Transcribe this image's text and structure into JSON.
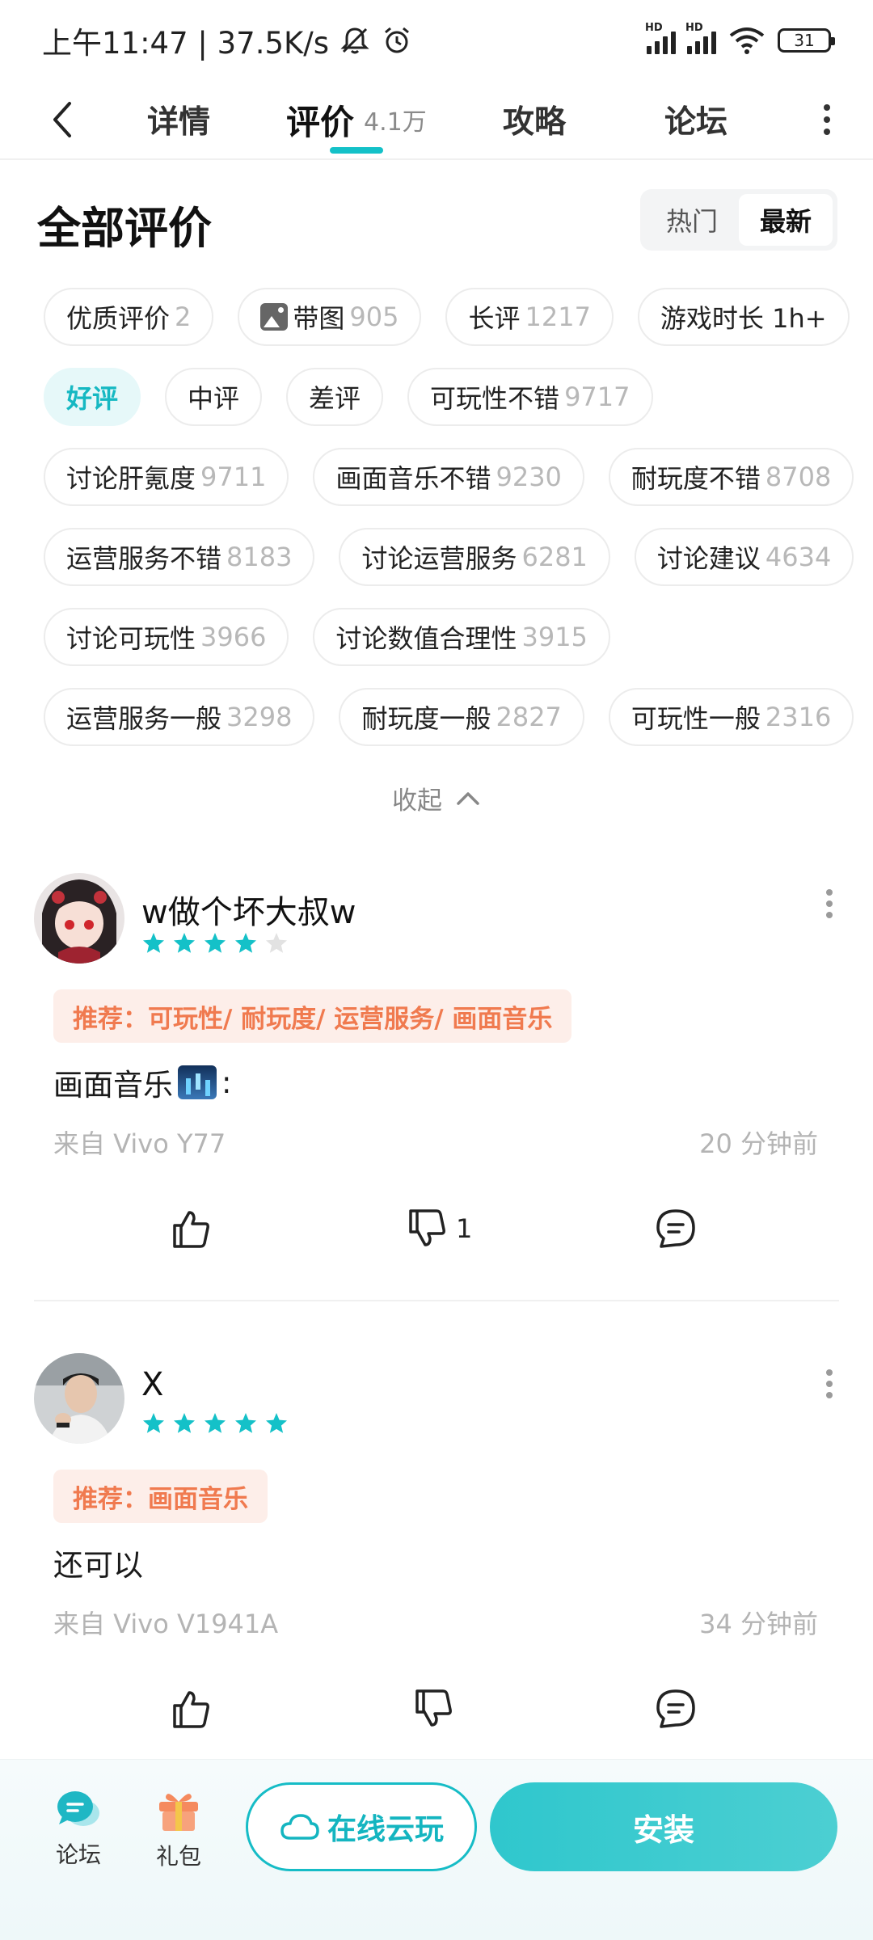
{
  "status_bar": {
    "time_speed": "上午11:47 | 37.5K/s",
    "battery": "31",
    "hd_label": "HD"
  },
  "nav": {
    "tabs": [
      {
        "label": "详情"
      },
      {
        "label": "评价",
        "count": "4.1万"
      },
      {
        "label": "攻略"
      },
      {
        "label": "论坛"
      }
    ]
  },
  "section": {
    "title": "全部评价",
    "sort": [
      "热门",
      "最新"
    ],
    "sort_selected": "最新"
  },
  "filters": [
    [
      {
        "label": "优质评价",
        "count": "2"
      },
      {
        "label": "带图",
        "count": "905",
        "icon": "image-icon"
      },
      {
        "label": "长评",
        "count": "1217"
      },
      {
        "label": "游戏时长 1h+",
        "count": ""
      }
    ],
    [
      {
        "label": "好评",
        "count": "",
        "active": true
      },
      {
        "label": "中评",
        "count": ""
      },
      {
        "label": "差评",
        "count": ""
      },
      {
        "label": "可玩性不错",
        "count": "9717"
      }
    ],
    [
      {
        "label": "讨论肝氪度",
        "count": "9711"
      },
      {
        "label": "画面音乐不错",
        "count": "9230"
      },
      {
        "label": "耐玩度不错",
        "count": "8708"
      }
    ],
    [
      {
        "label": "运营服务不错",
        "count": "8183"
      },
      {
        "label": "讨论运营服务",
        "count": "6281"
      },
      {
        "label": "讨论建议",
        "count": "4634"
      }
    ],
    [
      {
        "label": "讨论可玩性",
        "count": "3966"
      },
      {
        "label": "讨论数值合理性",
        "count": "3915"
      }
    ],
    [
      {
        "label": "运营服务一般",
        "count": "3298"
      },
      {
        "label": "耐玩度一般",
        "count": "2827"
      },
      {
        "label": "可玩性一般",
        "count": "2316"
      }
    ]
  ],
  "collapse_label": "收起",
  "reviews": [
    {
      "username": "w做个坏大叔w",
      "rating": 4,
      "recommend": "推荐：可玩性/ 耐玩度/ 运营服务/ 画面音乐",
      "text": "画面音乐",
      "text_suffix": ":",
      "device": "来自 Vivo Y77",
      "time": "20 分钟前",
      "dislikes": "1"
    },
    {
      "username": "X",
      "rating": 5,
      "recommend": "推荐：画面音乐",
      "text": "还可以",
      "device": "来自 Vivo V1941A",
      "time": "34 分钟前",
      "dislikes": ""
    }
  ],
  "bottom_bar": {
    "forum_label": "论坛",
    "gift_label": "礼包",
    "cloud_play_label": "在线云玩",
    "install_label": "安装"
  },
  "colors": {
    "accent": "#14c1c8",
    "recommend_text": "#f07a4f",
    "recommend_bg": "#fdeee9",
    "star_filled": "#14c1c8",
    "star_empty": "#e2e2e2"
  }
}
